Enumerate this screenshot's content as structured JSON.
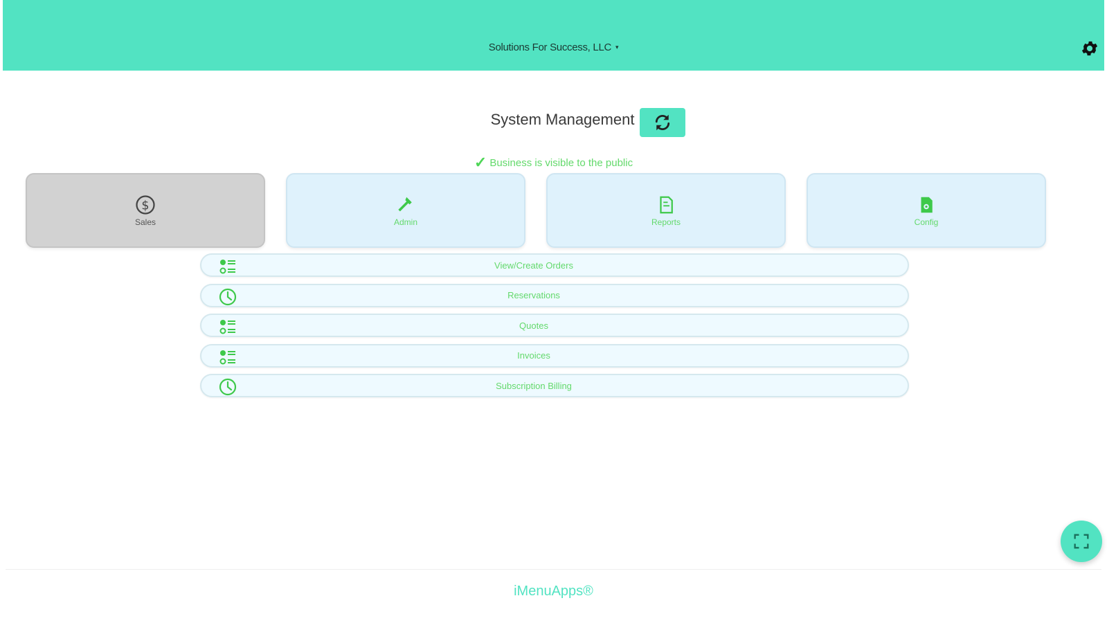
{
  "header": {
    "business_name": "Solutions For Success, LLC",
    "caret": "▾",
    "settings_icon": "gear-icon",
    "color": "#52e3c2"
  },
  "main": {
    "title": "System Management",
    "refresh_icon": "refresh-icon",
    "visibility_check": "✓",
    "visibility_text": "Business is visible to the public"
  },
  "cards": [
    {
      "label": "Sales",
      "icon": "dollar-icon",
      "active": true
    },
    {
      "label": "Admin",
      "icon": "hammer-icon",
      "active": false
    },
    {
      "label": "Reports",
      "icon": "document-icon",
      "active": false
    },
    {
      "label": "Config",
      "icon": "config-file-icon",
      "active": false
    }
  ],
  "menu": [
    {
      "label": "View/Create Orders",
      "icon": "list-icon"
    },
    {
      "label": "Reservations",
      "icon": "clock-icon"
    },
    {
      "label": "Quotes",
      "icon": "list-icon"
    },
    {
      "label": "Invoices",
      "icon": "list-icon"
    },
    {
      "label": "Subscription Billing",
      "icon": "clock-icon"
    }
  ],
  "fab_icon": "fullscreen-icon",
  "footer": {
    "brand": "iMenuApps®"
  },
  "colors": {
    "accent": "#52e3c2",
    "text_green": "#63d96b",
    "card_bg": "#dff2fc",
    "card_active": "#d2d2d2"
  }
}
